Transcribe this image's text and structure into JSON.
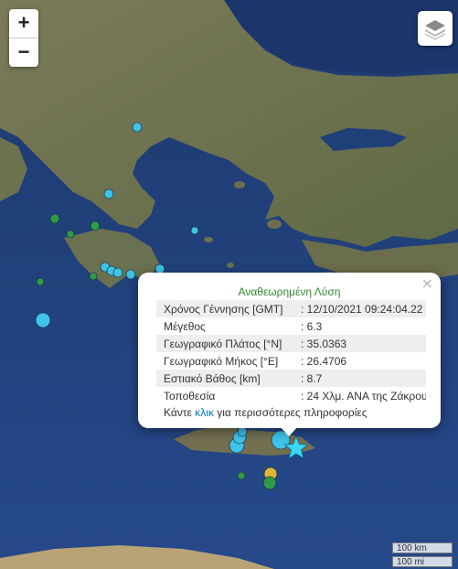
{
  "zoom": {
    "in_label": "+",
    "out_label": "−"
  },
  "popup": {
    "close_label": "×",
    "title": "Αναθεωρημένη Λύση",
    "rows": [
      {
        "label": "Χρόνος Γέννησης [GMT]",
        "value": ": 12/10/2021 09:24:04.22"
      },
      {
        "label": "Μέγεθος",
        "value": ": 6.3"
      },
      {
        "label": "Γεωγραφικό Πλάτος [°N]",
        "value": ": 35.0363"
      },
      {
        "label": "Γεωγραφικό Μήκος [°E]",
        "value": ": 26.4706"
      },
      {
        "label": "Εστιακό Βάθος [km]",
        "value": ": 8.7"
      },
      {
        "label": "Τοποθεσία",
        "value": ": 24 Χλμ. ΑΝΑ της Ζάκρου"
      }
    ],
    "more_prefix": "Κάντε ",
    "more_link": "κλικ",
    "more_suffix": " για περισσότερες πληροφορίες"
  },
  "scale": {
    "km_label": "100 km",
    "mi_label": "100 mi"
  },
  "colors": {
    "sea": "#1e3f78",
    "land": "#6f7553",
    "marker_cyan": "#3fc3e8",
    "marker_green": "#2e9a4a",
    "marker_yellow": "#e0b43a",
    "star": "#39d6f5"
  }
}
